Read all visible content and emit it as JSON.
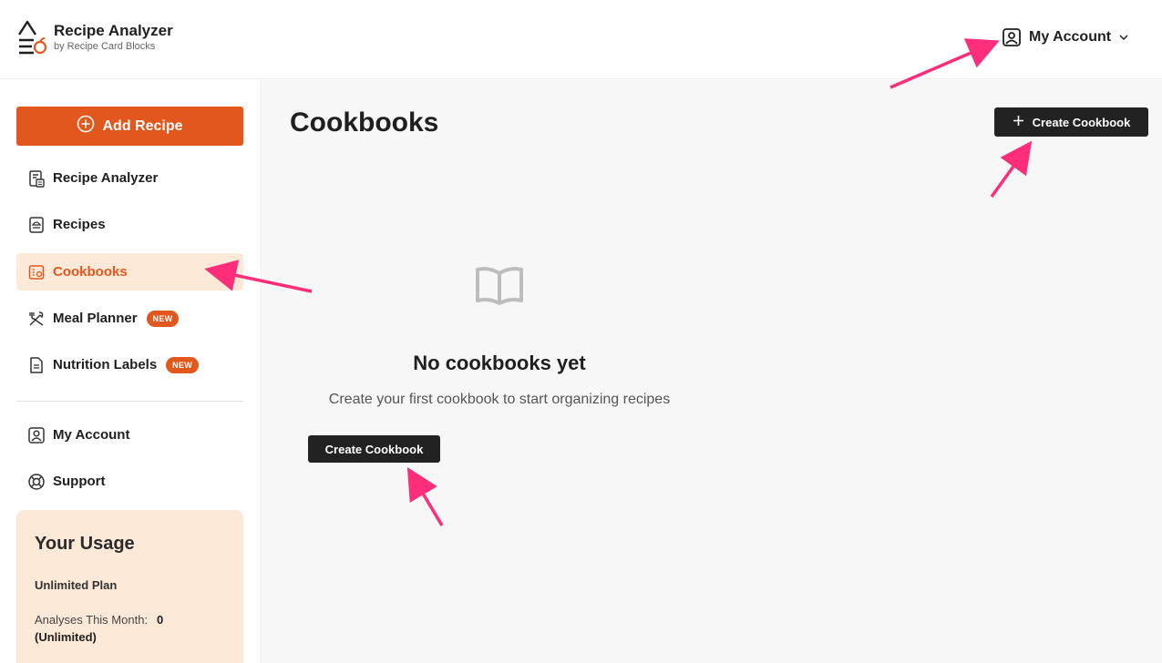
{
  "brand": {
    "title": "Recipe Analyzer",
    "subtitle": "by Recipe Card Blocks"
  },
  "header": {
    "account_label": "My Account"
  },
  "sidebar": {
    "add_button": "Add Recipe",
    "items": [
      {
        "label": "Recipe Analyzer",
        "icon": "recipe-analyzer-icon"
      },
      {
        "label": "Recipes",
        "icon": "recipes-book-icon"
      },
      {
        "label": "Cookbooks",
        "icon": "cookbooks-icon",
        "active": true
      },
      {
        "label": "Meal Planner",
        "icon": "utensils-icon",
        "badge": "NEW"
      },
      {
        "label": "Nutrition Labels",
        "icon": "document-icon",
        "badge": "NEW"
      }
    ],
    "secondary": [
      {
        "label": "My Account",
        "icon": "user-icon"
      },
      {
        "label": "Support",
        "icon": "lifebuoy-icon"
      }
    ],
    "usage": {
      "title": "Your Usage",
      "plan": "Unlimited Plan",
      "analyses_label": "Analyses This Month:",
      "analyses_value": "0",
      "analyses_limit": "(Unlimited)"
    }
  },
  "main": {
    "title": "Cookbooks",
    "create_button": "Create Cookbook",
    "empty_title": "No cookbooks yet",
    "empty_subtitle": "Create your first cookbook to start organizing recipes",
    "empty_button": "Create Cookbook"
  },
  "colors": {
    "accent": "#e2571d",
    "active_bg": "#fde9d7",
    "dark_button": "#222222",
    "annotation_arrow": "#ff2d7a"
  }
}
